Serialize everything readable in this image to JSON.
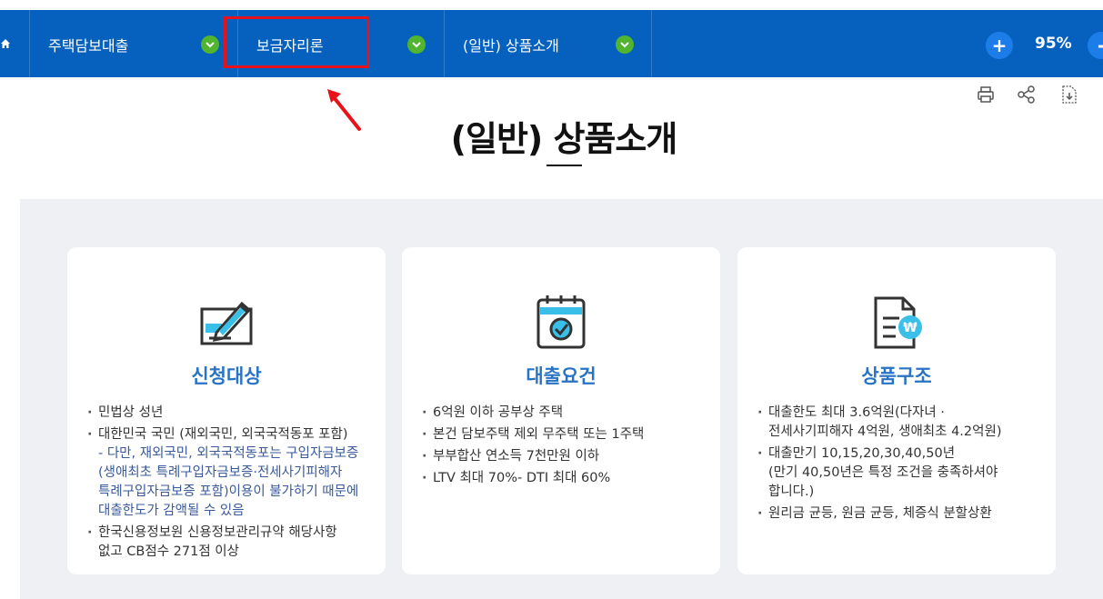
{
  "nav": {
    "menus": [
      {
        "label": "주택담보대출"
      },
      {
        "label": "보금자리론"
      },
      {
        "label": "(일반) 상품소개"
      }
    ],
    "zoom_value": "95%",
    "zoom_in_label": "+",
    "zoom_out_label": "-"
  },
  "page": {
    "title": "(일반) 상품소개"
  },
  "cards": [
    {
      "title": "신청대상",
      "icon": "pen-check-icon",
      "items": [
        {
          "text": "민법상 성년"
        },
        {
          "text": "대한민국 국민 (재외국민, 외국국적동포 포함)",
          "sub": "- 다만, 재외국민, 외국국적동포는 구입자금보증\n(생애최초 특례구입자금보증·전세사기피해자\n특례구입자금보증 포함)이용이 불가하기 때문에\n대출한도가 감액될 수 있음"
        },
        {
          "text": "한국신용정보원 신용정보관리규약 해당사항\n없고 CB점수 271점 이상"
        }
      ]
    },
    {
      "title": "대출요건",
      "icon": "calendar-check-icon",
      "items": [
        {
          "text": "6억원 이하 공부상 주택"
        },
        {
          "text": "본건 담보주택 제외 무주택 또는 1주택"
        },
        {
          "text": "부부합산 연소득 7천만원 이하"
        },
        {
          "text": "LTV 최대 70%- DTI 최대 60%"
        }
      ]
    },
    {
      "title": "상품구조",
      "icon": "document-won-icon",
      "items": [
        {
          "text": "대출한도 최대 3.6억원(다자녀 ·\n전세사기피해자 4억원, 생애최초 4.2억원)"
        },
        {
          "text": "대출만기 10,15,20,30,40,50년\n(만기 40,50년은 특정 조건을 충족하셔야\n합니다.)"
        },
        {
          "text": "원리금 균등, 원금 균등, 체증식 분할상환"
        }
      ]
    }
  ],
  "colors": {
    "nav_bg": "#0561bd",
    "chevron_green": "#52b52f",
    "card_title": "#2873c4",
    "highlight_red": "#e8121b",
    "panel_bg": "#eef0f4"
  }
}
